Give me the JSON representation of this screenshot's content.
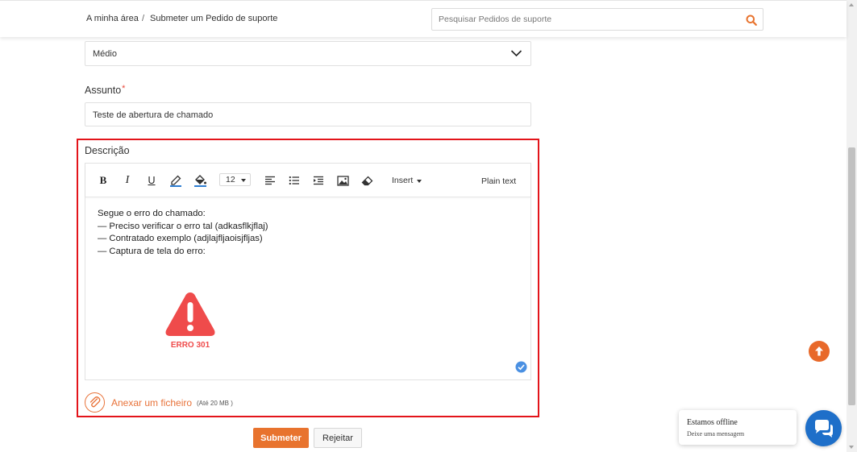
{
  "header": {
    "breadcrumb": [
      {
        "label": "A minha área"
      },
      {
        "label": "Submeter um Pedido de suporte"
      }
    ],
    "breadcrumb_separator": "/",
    "search": {
      "placeholder": "Pesquisar Pedidos de suporte",
      "value": "",
      "icon": "search-icon"
    }
  },
  "form": {
    "priority": {
      "value": "Médio",
      "icon": "chevron-down-icon"
    },
    "subject": {
      "label": "Assunto",
      "required_mark": "*",
      "value": "Teste de abertura de chamado"
    },
    "description": {
      "label": "Descrição",
      "toolbar": {
        "bold": "B",
        "italic": "I",
        "underline": "U",
        "font_size": "12",
        "insert_label": "Insert",
        "plain_text_label": "Plain text"
      },
      "content_lines": [
        "Segue o erro do chamado:",
        "— Preciso verificar o erro tal (adkasflkjflaj)",
        "— Contratado exemplo (adjlajfljaoisjfljas)",
        "— Captura de tela do erro:"
      ],
      "image_caption": "ERRO 301"
    },
    "attach": {
      "label": "Anexar um ficheiro",
      "limit": "(Até 20 MB )"
    },
    "submit_label": "Submeter",
    "reject_label": "Rejeitar"
  },
  "chat": {
    "title": "Estamos offline",
    "subtitle": "Deixe uma mensagem"
  },
  "colors": {
    "accent": "#e8732e",
    "highlight": "#e3141a",
    "error_red": "#ef4b4b",
    "chat_blue": "#1e6fc9",
    "check_blue": "#4a90e2"
  }
}
